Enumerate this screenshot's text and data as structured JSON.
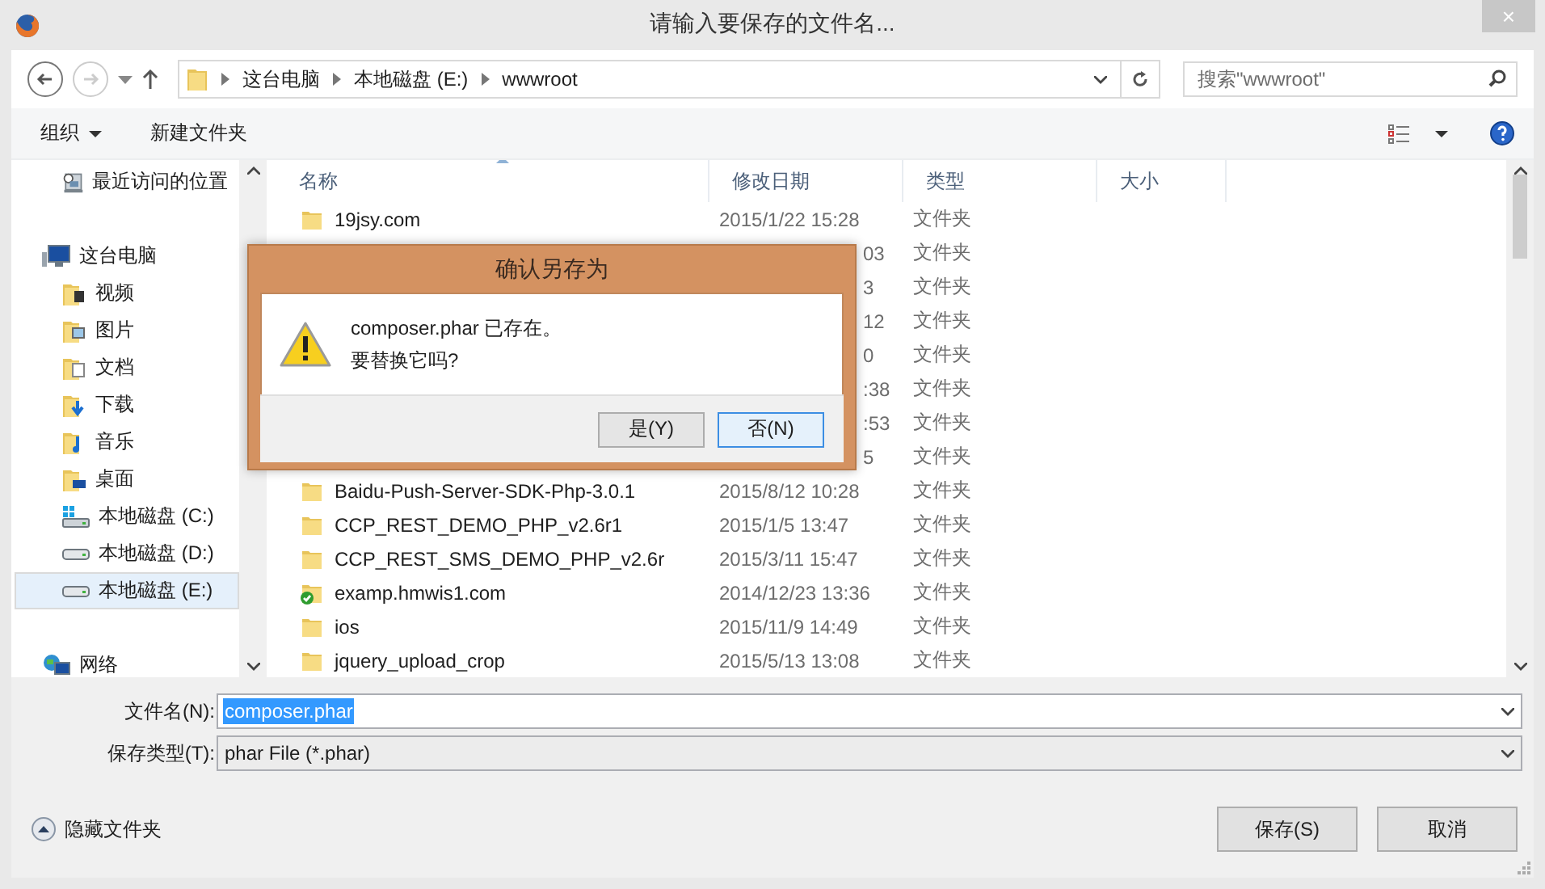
{
  "window": {
    "title": "请输入要保存的文件名...",
    "close": "×"
  },
  "nav": {
    "back_disabled": false,
    "forward_disabled": true,
    "breadcrumb": [
      "这台电脑",
      "本地磁盘 (E:)",
      "wwwroot"
    ],
    "search": {
      "placeholder": "搜索\"wwwroot\""
    }
  },
  "toolbar": {
    "organize": "组织",
    "new_folder": "新建文件夹"
  },
  "sidebar": {
    "items": [
      {
        "label": "最近访问的位置",
        "kind": "recent",
        "selected": false
      },
      {
        "label": "这台电脑",
        "kind": "pc",
        "selected": false,
        "children": [
          {
            "label": "视频",
            "kind": "video",
            "selected": false
          },
          {
            "label": "图片",
            "kind": "pictures",
            "selected": false
          },
          {
            "label": "文档",
            "kind": "documents",
            "selected": false
          },
          {
            "label": "下载",
            "kind": "downloads",
            "selected": false
          },
          {
            "label": "音乐",
            "kind": "music",
            "selected": false
          },
          {
            "label": "桌面",
            "kind": "desktop",
            "selected": false
          },
          {
            "label": "本地磁盘 (C:)",
            "kind": "system",
            "selected": false
          },
          {
            "label": "本地磁盘 (D:)",
            "kind": "drive",
            "selected": false
          },
          {
            "label": "本地磁盘 (E:)",
            "kind": "drive",
            "selected": true
          }
        ]
      },
      {
        "label": "网络",
        "kind": "network",
        "selected": false
      }
    ]
  },
  "table": {
    "columns": [
      "名称",
      "修改日期",
      "类型",
      "大小"
    ],
    "rows": [
      {
        "kind": "folder",
        "name": "19jsy.com",
        "date": "2015/1/22 15:28",
        "type": "文件夹"
      },
      {
        "date": "03",
        "type": "文件夹"
      },
      {
        "date": "3",
        "type": "文件夹"
      },
      {
        "date": "12",
        "type": "文件夹"
      },
      {
        "date": "0",
        "type": "文件夹"
      },
      {
        "date": ":38",
        "type": "文件夹"
      },
      {
        "date": ":53",
        "type": "文件夹"
      },
      {
        "date": "5",
        "type": "文件夹"
      },
      {
        "kind": "folder",
        "name": "Baidu-Push-Server-SDK-Php-3.0.1",
        "date": "2015/8/12 10:28",
        "type": "文件夹"
      },
      {
        "kind": "folder",
        "name": "CCP_REST_DEMO_PHP_v2.6r1",
        "date": "2015/1/5 13:47",
        "type": "文件夹"
      },
      {
        "kind": "folder",
        "name": "CCP_REST_SMS_DEMO_PHP_v2.6r",
        "date": "2015/3/11 15:47",
        "type": "文件夹"
      },
      {
        "kind": "synced",
        "name": "examp.hmwis1.com",
        "date": "2014/12/23 13:36",
        "type": "文件夹"
      },
      {
        "kind": "folder",
        "name": "ios",
        "date": "2015/11/9 14:49",
        "type": "文件夹"
      },
      {
        "kind": "folder",
        "name": "jquery_upload_crop",
        "date": "2015/5/13 13:08",
        "type": "文件夹"
      }
    ]
  },
  "form": {
    "filename_label": "文件名(N):",
    "filename": "composer.phar",
    "filename_selected": true,
    "type_label": "保存类型(T):",
    "type": "phar File (*.phar)"
  },
  "footer": {
    "hide_folders": "隐藏文件夹",
    "save": "保存(S)",
    "cancel": "取消"
  },
  "dialog": {
    "title": "确认另存为",
    "message": "composer.phar 已存在。",
    "question": "要替换它吗?",
    "buttons": [
      {
        "label": "是(Y)",
        "default": false
      },
      {
        "label": "否(N)",
        "default": true
      }
    ]
  }
}
